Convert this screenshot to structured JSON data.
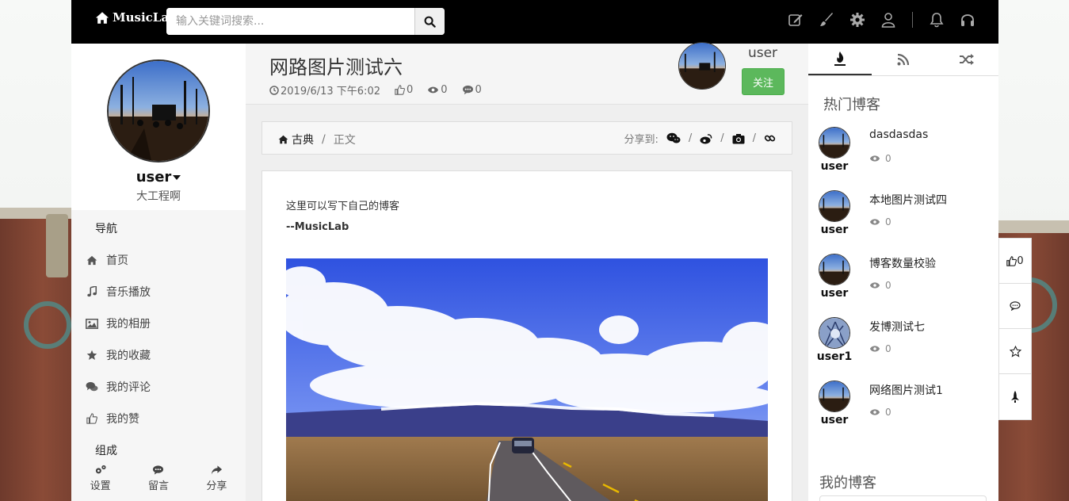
{
  "topbar": {
    "brand": "MusicLab",
    "search_placeholder": "输入关键词搜索..."
  },
  "sidebar": {
    "username": "user",
    "subtitle": "大工程啊",
    "nav_heading": "导航",
    "nav_items": [
      {
        "label": "首页",
        "icon": "home-icon"
      },
      {
        "label": "音乐播放",
        "icon": "music-icon"
      },
      {
        "label": "我的相册",
        "icon": "image-icon"
      },
      {
        "label": "我的收藏",
        "icon": "star-icon"
      },
      {
        "label": "我的评论",
        "icon": "comments-icon"
      },
      {
        "label": "我的赞",
        "icon": "thumbs-up-icon"
      }
    ],
    "group_heading": "组成",
    "bottom": [
      {
        "label": "设置",
        "icon": "cogs-icon"
      },
      {
        "label": "留言",
        "icon": "comment-icon"
      },
      {
        "label": "分享",
        "icon": "share-icon"
      }
    ]
  },
  "post": {
    "title": "网路图片测试六",
    "date": "2019/6/13 下午6:02",
    "likes": "0",
    "views": "0",
    "comments": "0",
    "author": "user",
    "follow_label": "关注",
    "breadcrumb": {
      "home": "古典",
      "sep": "/",
      "current": "正文"
    },
    "share_label": "分享到:",
    "body_line": "这里可以写下自己的博客",
    "signature": "--MusicLab"
  },
  "right": {
    "hot_heading": "热门博客",
    "blogs": [
      {
        "title": "dasdasdas",
        "user": "user",
        "views": "0"
      },
      {
        "title": "本地图片测试四",
        "user": "user",
        "views": "0"
      },
      {
        "title": "博客数量校验",
        "user": "user",
        "views": "0"
      },
      {
        "title": "发博测试七",
        "user": "user1",
        "views": "0"
      },
      {
        "title": "网络图片测试1",
        "user": "user",
        "views": "0"
      }
    ],
    "my_heading": "我的博客"
  },
  "float": {
    "likes": "0"
  },
  "colors": {
    "topbar": "#000000",
    "follow": "#5cb85c"
  }
}
